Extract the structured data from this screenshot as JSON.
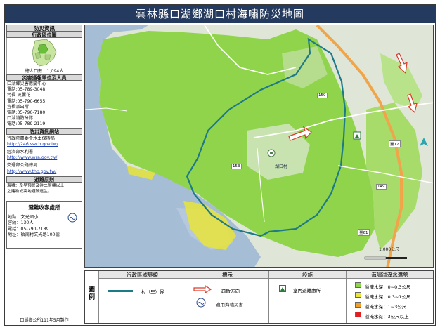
{
  "title": "雲林縣口湖鄉湖口村海嘯防災地圖",
  "sidebar": {
    "header": "防災資訊",
    "admin_location_title": "行政區位圖",
    "population": "總人口數：1,094人",
    "contacts_title": "災害通報單位及人員",
    "contacts": [
      "口湖鄉災害應變中心",
      "電話:05-789-3048",
      "村長-吳麗花",
      "電話:05-790-6655",
      "宜梧派出所",
      "電話:05-790-7180",
      "口湖消防分隊",
      "電話:05-789-2119"
    ],
    "websites_title": "防災資訊網站",
    "websites": [
      {
        "name": "行政院農委會水土保持局",
        "url": "http://246.swcb.gov.tw/"
      },
      {
        "name": "經濟部水利署",
        "url": "http://www.wra.gov.tw/"
      },
      {
        "name": "交通部公路總局",
        "url": "http://www.thb.gov.tw/"
      }
    ],
    "principle_title": "避難原則",
    "principle_text_1": "海嘯：及早預警及往二層樓以上",
    "principle_text_2": "之建物或高地避難逃生。",
    "shelter_title": "避難收容處所",
    "shelter": [
      "地點：文光國小",
      "容納：130人",
      "電話：05-790-7189",
      "地址：梧南村文光路100號"
    ],
    "footer": "口湖鄉公所111年5月製作"
  },
  "map": {
    "scale_label": "1,000公尺",
    "road_labels": [
      "臺17",
      "臺61",
      "159",
      "153",
      "149"
    ],
    "village_label": "湖口村",
    "colors": {
      "sea": "#a6bdd6",
      "land": "#d8e3d3",
      "flood_green": "#8fd44b",
      "flood_yellow": "#e8e43a",
      "boundary": "#1f7a88",
      "road_orange": "#f0a54a",
      "arrow_red": "#d93a2b"
    }
  },
  "legend": {
    "label": "圖例",
    "admin_header": "行政區域界線",
    "admin_item": "村（里）界",
    "sign_header": "標示",
    "sign_items": [
      "疏散方向",
      "適用海嘯災害"
    ],
    "facility_header": "設施",
    "facility_item": "室內避難處所",
    "flood_header": "海嘯溢淹水潛勢",
    "flood_items": [
      {
        "label": "溢淹水深：0~0.3公尺",
        "color": "#8fd44b"
      },
      {
        "label": "溢淹水深：0.3~1公尺",
        "color": "#e8e43a"
      },
      {
        "label": "溢淹水深：1~3公尺",
        "color": "#f0a02a"
      },
      {
        "label": "溢淹水深：3公尺以上",
        "color": "#e02020"
      }
    ]
  }
}
